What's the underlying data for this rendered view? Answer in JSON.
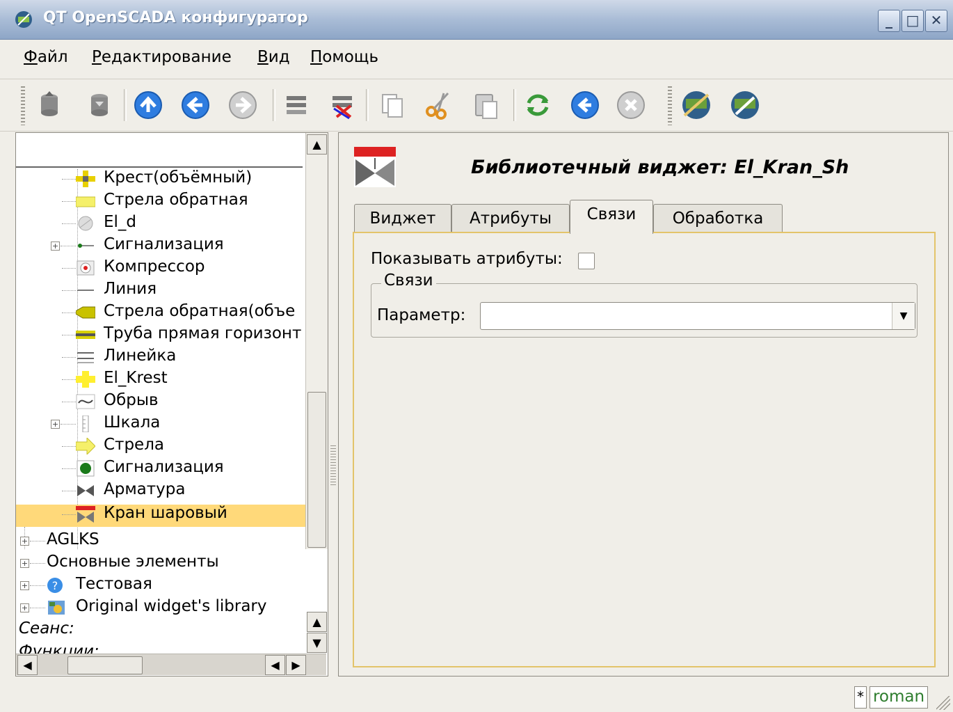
{
  "window": {
    "title": "QT OpenSCADA конфигуратор",
    "buttons": {
      "minimize": "_",
      "maximize": "□",
      "close": "✕"
    }
  },
  "menu": [
    {
      "label_underlined": "Ф",
      "label_rest": "айл"
    },
    {
      "label_underlined": "Р",
      "label_rest": "едактирование"
    },
    {
      "label_underlined": "В",
      "label_rest": "ид"
    },
    {
      "label_underlined": "П",
      "label_rest": "омощь"
    }
  ],
  "toolbar": {
    "icons": [
      "db-load-icon",
      "db-save-icon",
      "up-icon",
      "back-icon",
      "forward-icon",
      "add-item-icon",
      "delete-item-icon",
      "copy-icon",
      "cut-icon",
      "paste-icon",
      "refresh-icon",
      "start-icon",
      "stop-icon",
      "ui-icon-1",
      "ui-icon-2"
    ]
  },
  "tree": {
    "items": [
      {
        "label": "Крест(объёмный)",
        "icon": "cross-icon"
      },
      {
        "label": "Стрела обратная",
        "icon": "reverse-arrow-icon"
      },
      {
        "label": "El_d",
        "icon": "el-d-icon"
      },
      {
        "label": "Сигнализация",
        "icon": "signal-line-icon",
        "expandable": true
      },
      {
        "label": "Компрессор",
        "icon": "compressor-icon"
      },
      {
        "label": "Линия",
        "icon": "line-icon"
      },
      {
        "label": "Стрела обратная(объе",
        "icon": "reverse-arrow-3d-icon"
      },
      {
        "label": "Труба прямая горизонт",
        "icon": "pipe-icon"
      },
      {
        "label": "Линейка",
        "icon": "ruler-icon"
      },
      {
        "label": "El_Krest",
        "icon": "el-krest-icon"
      },
      {
        "label": "Обрыв",
        "icon": "break-icon"
      },
      {
        "label": "Шкала",
        "icon": "scale-icon",
        "expandable": true
      },
      {
        "label": "Стрела",
        "icon": "arrow-icon"
      },
      {
        "label": "Сигнализация",
        "icon": "signal-dot-icon"
      },
      {
        "label": "Арматура",
        "icon": "valve-icon"
      },
      {
        "label": "Кран шаровый",
        "icon": "ball-valve-icon",
        "selected": true
      }
    ],
    "root_items": [
      {
        "label": "AGLKS"
      },
      {
        "label": "Основные элементы"
      },
      {
        "label": "Тестовая",
        "icon": "help-icon"
      },
      {
        "label": "Original widget's library",
        "icon": "library-icon"
      }
    ],
    "session_label": "Сеанс:",
    "functions_label": "Функции:"
  },
  "widget": {
    "title": "Библиотечный виджет: El_Kran_Sh",
    "tabs": [
      "Виджет",
      "Атрибуты",
      "Связи",
      "Обработка"
    ],
    "active_tab": "Связи",
    "show_attributes_label": "Показывать атрибуты:",
    "show_attributes_checked": false,
    "links_group_title": "Связи",
    "parameter_label": "Параметр:",
    "parameter_value": ""
  },
  "status": {
    "modified_marker": "*",
    "user": "roman"
  },
  "colors": {
    "selection": "#ffd97a",
    "tab_pane_border": "#e3c46a",
    "user_text": "#2e7d2e"
  }
}
